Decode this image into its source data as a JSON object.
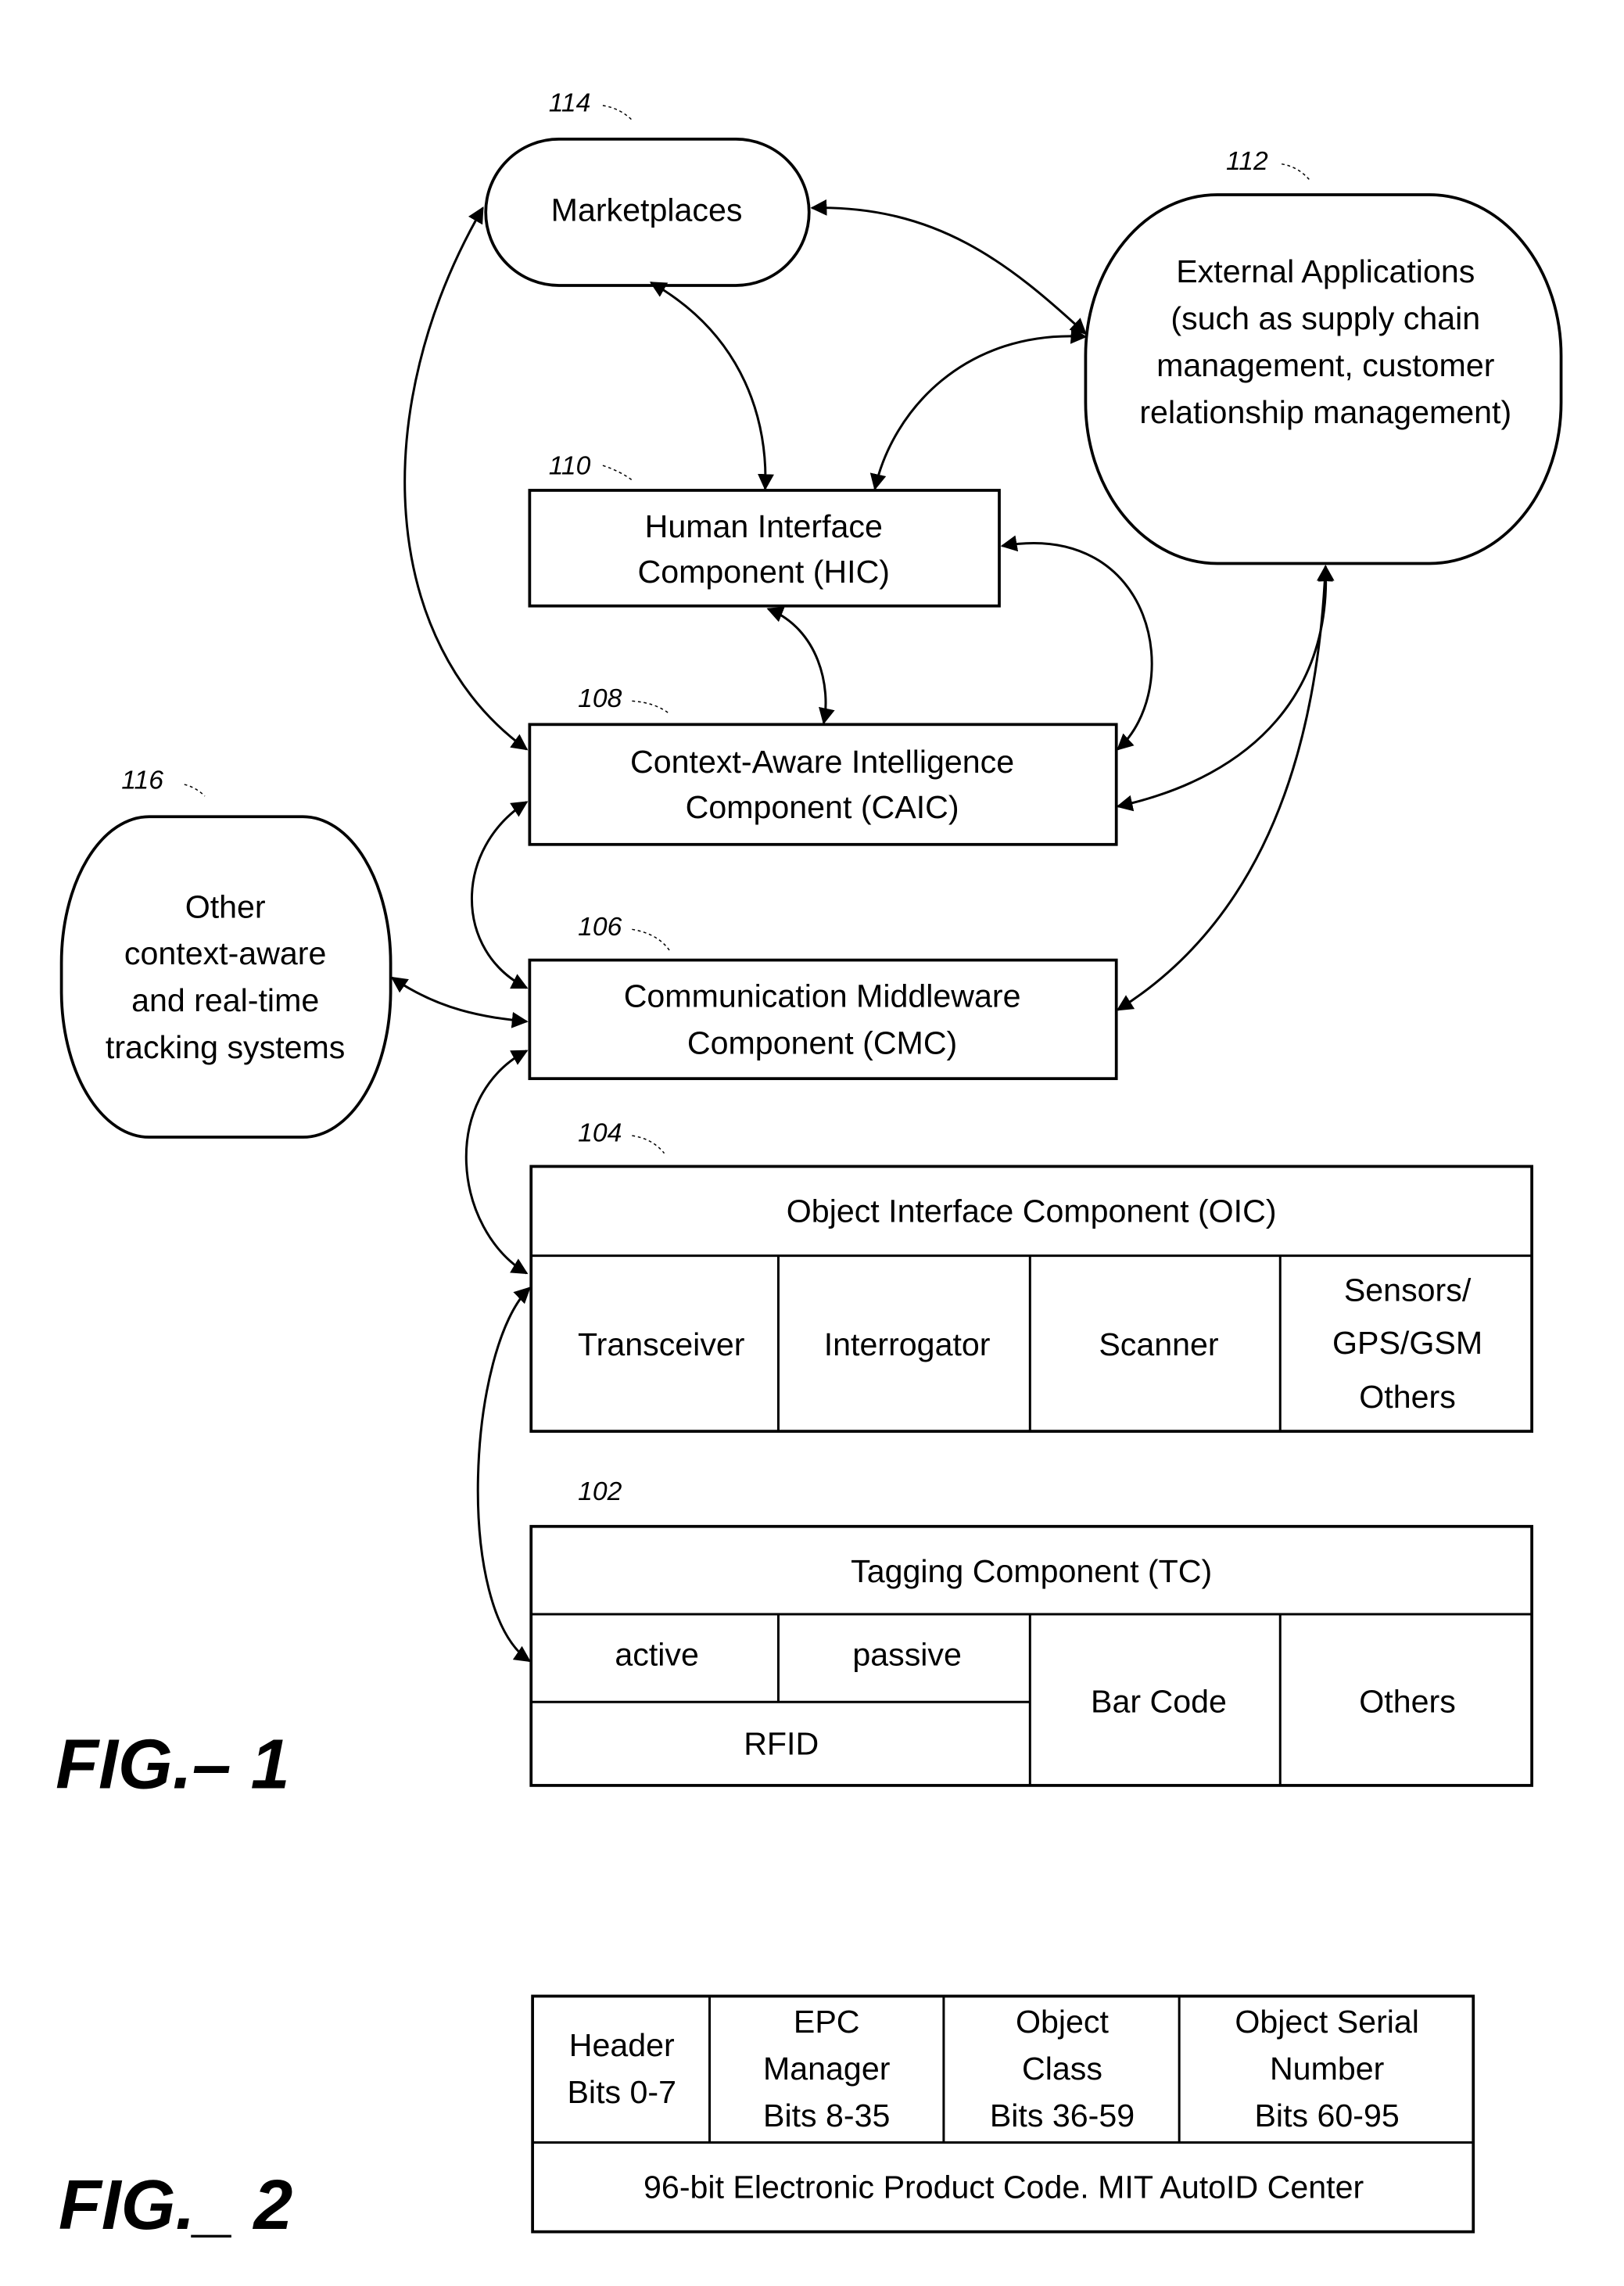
{
  "fig1": {
    "caption": "FIG.– 1",
    "nodes": {
      "marketplaces": {
        "ref": "114",
        "label": [
          "Marketplaces"
        ]
      },
      "external_apps": {
        "ref": "112",
        "label": [
          "External Applications",
          "(such as supply chain",
          "management, customer",
          "relationship management)"
        ]
      },
      "hic": {
        "ref": "110",
        "label": [
          "Human Interface",
          "Component (HIC)"
        ]
      },
      "caic": {
        "ref": "108",
        "label": [
          "Context-Aware Intelligence",
          "Component (CAIC)"
        ]
      },
      "cmc": {
        "ref": "106",
        "label": [
          "Communication Middleware",
          "Component (CMC)"
        ]
      },
      "other_systems": {
        "ref": "116",
        "label": [
          "Other",
          "context-aware",
          "and real-time",
          "tracking systems"
        ]
      },
      "oic": {
        "ref": "104",
        "title": "Object Interface Component (OIC)",
        "cells": [
          [
            "Transceiver"
          ],
          [
            "Interrogator"
          ],
          [
            "Scanner"
          ],
          [
            "Sensors/",
            "GPS/GSM",
            "Others"
          ]
        ]
      },
      "tc": {
        "ref": "102",
        "title": "Tagging Component (TC)",
        "rfid_sub": [
          "active",
          "passive"
        ],
        "rfid_label": "RFID",
        "cells": [
          "Bar Code",
          "Others"
        ]
      }
    }
  },
  "fig2": {
    "caption": "FIG._ 2",
    "fields": [
      [
        "Header",
        "Bits 0-7"
      ],
      [
        "EPC",
        "Manager",
        "Bits 8-35"
      ],
      [
        "Object",
        "Class",
        "Bits 36-59"
      ],
      [
        "Object Serial",
        "Number",
        "Bits 60-95"
      ]
    ],
    "footer": "96-bit Electronic Product Code.  MIT AutoID Center"
  }
}
